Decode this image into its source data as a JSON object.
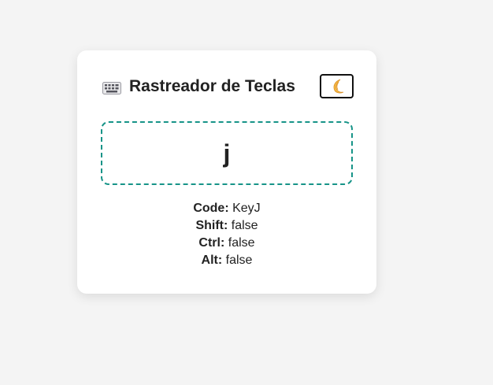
{
  "header": {
    "icon": "keyboard-icon",
    "title": "Rastreador de Teclas",
    "theme_toggle_icon": "crescent-moon-icon"
  },
  "key_display": {
    "key": "j"
  },
  "details": [
    {
      "label": "Code:",
      "value": "KeyJ"
    },
    {
      "label": "Shift:",
      "value": "false"
    },
    {
      "label": "Ctrl:",
      "value": "false"
    },
    {
      "label": "Alt:",
      "value": "false"
    }
  ],
  "colors": {
    "background": "#f4f4f4",
    "card": "#ffffff",
    "dashed_border": "#179488",
    "text": "#222222"
  }
}
